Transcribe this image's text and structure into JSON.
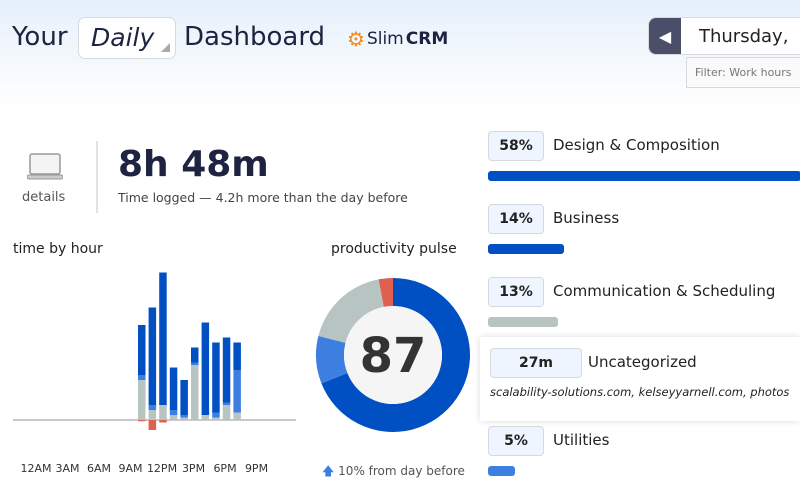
{
  "header": {
    "title_prefix": "Your",
    "period": "Daily",
    "title_suffix": "Dashboard",
    "logo_light": "Slim",
    "logo_bold": "CRM",
    "date": "Thursday,",
    "filter": "Filter: Work hours"
  },
  "summary": {
    "details_label": "details",
    "total": "8h 48m",
    "subtitle": "Time logged — 4.2h more than the day before"
  },
  "chart_data": [
    {
      "type": "bar",
      "title": "time by hour",
      "stacked": true,
      "tick_labels": [
        "12AM",
        "3AM",
        "6AM",
        "9AM",
        "12PM",
        "3PM",
        "6PM",
        "9PM"
      ],
      "categories": [
        "10AM",
        "11AM",
        "12PM",
        "1PM",
        "2PM",
        "3PM",
        "4PM",
        "5PM",
        "6PM",
        "7PM"
      ],
      "series": [
        {
          "color": "#b8c4c2",
          "values": [
            16,
            4,
            6,
            2,
            1,
            22,
            2,
            1,
            6,
            3
          ]
        },
        {
          "color": "#3d7fe0",
          "values": [
            2,
            2,
            0,
            2,
            1,
            1,
            0,
            2,
            1,
            17
          ]
        },
        {
          "color": "#0050c4",
          "values": [
            20,
            39,
            53,
            17,
            14,
            6,
            37,
            28,
            26,
            11
          ]
        },
        {
          "color": "#e06050",
          "values": [
            -0.5,
            -4,
            -1,
            0,
            0,
            0,
            0,
            0,
            0,
            0
          ]
        }
      ]
    },
    {
      "type": "pie",
      "title": "productivity pulse",
      "center_value": "87",
      "footer": "10% from day before",
      "values": [
        69,
        10,
        18,
        3
      ],
      "colors": [
        "#0050c4",
        "#3d7fe0",
        "#b8c4c2",
        "#e06050"
      ]
    }
  ],
  "categories": [
    {
      "badge": "58%",
      "name": "Design & Composition",
      "percent": 58,
      "color": "#0050c4"
    },
    {
      "badge": "14%",
      "name": "Business",
      "percent": 14,
      "color": "#0050c4"
    },
    {
      "badge": "13%",
      "name": "Communication & Scheduling",
      "percent": 13,
      "color": "#b8c4c2"
    },
    {
      "badge": "27m",
      "name": "Uncategorized",
      "sites": "scalability-solutions.com, kelseyyarnell.com, photos"
    },
    {
      "badge": "5%",
      "name": "Utilities",
      "percent": 5,
      "color": "#3d7fe0"
    }
  ]
}
